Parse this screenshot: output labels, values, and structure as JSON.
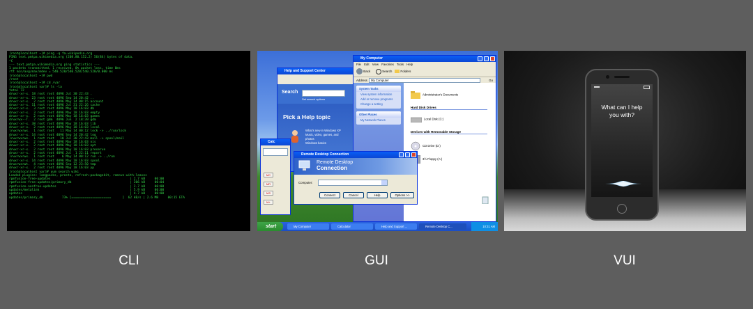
{
  "captions": {
    "cli": "CLI",
    "gui": "GUI",
    "vui": "VUI"
  },
  "colors": {
    "background": "#5e5e5e",
    "terminal_green": "#36d84a",
    "terminal_blue": "#3a7dff",
    "xp_blue": "#0a5ef5"
  },
  "cli": {
    "lines": [
      "[root@localhost ~]# ping -q fa.wikipedia.org",
      "PING text.pmtpa.wikimedia.org (208.80.152.2) 56(84) bytes of data.",
      "^C",
      "--- text.pmtpa.wikimedia.org ping statistics ---",
      "1 packets transmitted, 1 received, 0% packet loss, time 0ms",
      "rtt min/avg/max/mdev = 540.528/540.528/540.528/0.000 ms",
      "[root@localhost ~]# pwd",
      "/root",
      "[root@localhost ~]# cd /var",
      "[root@localhost var]# ls -la",
      "total 72",
      "drwxr-xr-x. 18 root root 4096 Jul 30 22:43 .",
      "drwxr-xr-x. 23 root root 4096 Sep 14 20:42 ..",
      "drwxr-xr-x.  2 root root 4096 May 14 00:15 account",
      "drwxr-xr-x. 11 root root 4096 Jul 31 22:26 cache",
      "drwxr-xr-x.  3 root root 4096 May 18 16:03 db",
      "drwxr-xr-x.  3 root root 4096 May 18 16:03 empty",
      "drwxr-xr-x.  2 root root 4096 May 18 16:03 games",
      "drwxrwx--T.  2 root gdm  4096 Jun  2 18:39 gdm",
      "drwxr-xr-x. 38 root root 4096 May 18 16:03 lib",
      "drwxr-xr-x.  2 root root 4096 May 18 16:03 local",
      "lrwxrwxrwx.  1 root root   11 May 14 00:12 lock -> ../run/lock",
      "drwxr-xr-x. 14 root root 4096 Sep 14 20:42 log",
      "lrwxrwxrwx.  1 root root   10 Jul 30 22:43 mail -> spool/mail",
      "drwxr-xr-x.  2 root root 4096 May 18 16:03 nis",
      "drwxr-xr-x.  2 root root 4096 May 18 16:03 opt",
      "drwxr-xr-x.  2 root root 4096 May 18 16:03 preserve",
      "drwxr-xr-x.  2 root root 4096 Jul  1 22:11 report",
      "lrwxrwxrwx.  1 root root    6 May 14 00:12 run -> ../run",
      "drwxr-xr-x. 14 root root 4096 May 18 16:03 spool",
      "drwxrwxrwt.  4 root root 4096 Sep 12 23:50 tmp",
      "drwxr-xr-x.  2 root root 4096 May 18 16:03 yp",
      "[root@localhost var]# yum search wiki",
      "Loaded plugins: langpacks, presto, refresh-packagekit, remove-with-leaves",
      "rpmfusion-free-updates                                          | 2.7 kB     00:00",
      "rpmfusion-free-updates/primary_db                               | 206 kB     00:04",
      "rpmfusion-nonfree-updates                                       | 2.7 kB     00:00",
      "updates/metalink                                                | 5.9 kB     00:00",
      "updates                                                         | 4.7 kB     00:00",
      "updates/primary_db          73% [=====================      ]  62 kB/s | 2.6 MB     00:15 ETA"
    ]
  },
  "gui": {
    "help_window": {
      "title": "Help and Support Center",
      "search_label": "Search",
      "set_search_options": "Set search options",
      "pick_topic": "Pick a Help topic",
      "links": [
        "What's new in Windows XP",
        "Music, video, games, and photos",
        "Windows basics"
      ]
    },
    "mycomputer": {
      "title": "My Computer",
      "menu": [
        "File",
        "Edit",
        "View",
        "Favorites",
        "Tools",
        "Help"
      ],
      "toolbar": {
        "back": "Back",
        "search": "Search",
        "folders": "Folders"
      },
      "address_label": "Address",
      "address_value": "My Computer",
      "go": "Go",
      "system_tasks": {
        "title": "System Tasks",
        "items": [
          "View system information",
          "Add or remove programs",
          "Change a setting"
        ]
      },
      "other_places": {
        "title": "Other Places",
        "items": [
          "My Network Places"
        ]
      },
      "admin_docs": "Administrator's Documents",
      "hard_disk_section": "Hard Disk Drives",
      "local_disk": "Local Disk (C:)",
      "removable_section": "Devices with Removable Storage",
      "cd_drive": "CD Drive (D:)",
      "floppy": "3½ Floppy (A:)"
    },
    "calculator": {
      "title": "Calc",
      "buttons": [
        "MC",
        "MR",
        "MS",
        "M+"
      ]
    },
    "rdc": {
      "title": "Remote Desktop Connection",
      "heading_line1": "Remote Desktop",
      "heading_line2": "Connection",
      "computer_label": "Computer:",
      "buttons": [
        "Connect",
        "Cancel",
        "Help",
        "Options >>"
      ]
    },
    "recycle_bin": "Recycle Bin",
    "taskbar": {
      "start": "start",
      "tasks": [
        "My Computer",
        "Calculator",
        "Help and Support ...",
        "Remote Desktop C..."
      ],
      "clock": "10:31 AM"
    }
  },
  "vui": {
    "prompt_line1": "What can I help",
    "prompt_line2": "you with?"
  }
}
